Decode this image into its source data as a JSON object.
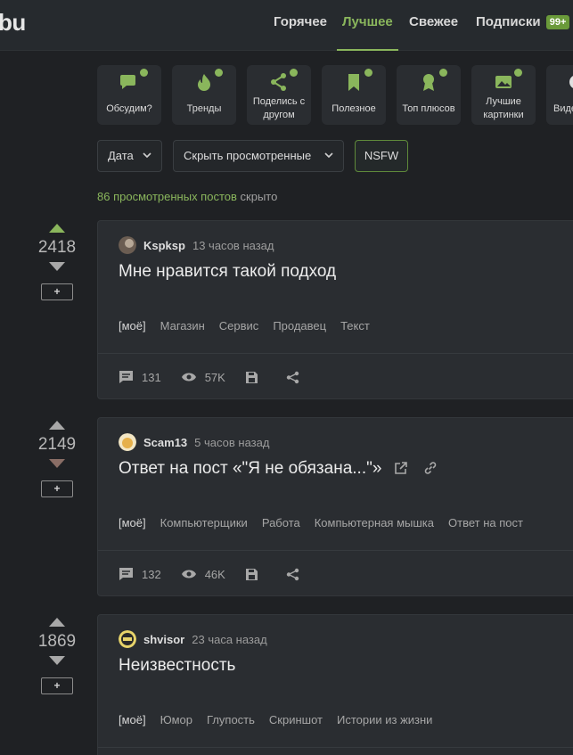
{
  "header": {
    "logo": "bu",
    "nav": [
      {
        "label": "Горячее",
        "active": false
      },
      {
        "label": "Лучшее",
        "active": true
      },
      {
        "label": "Свежее",
        "active": false
      },
      {
        "label": "Подписки",
        "active": false
      }
    ],
    "subscriptions_badge": "99+"
  },
  "categories": [
    {
      "line1": "Обсудим?",
      "line2": "",
      "icon": "chat-icon"
    },
    {
      "line1": "Тренды",
      "line2": "",
      "icon": "flame-icon"
    },
    {
      "line1": "Поделись с",
      "line2": "другом",
      "icon": "share-icon"
    },
    {
      "line1": "Полезное",
      "line2": "",
      "icon": "bookmark-icon"
    },
    {
      "line1": "Топ плюсов",
      "line2": "",
      "icon": "award-icon"
    },
    {
      "line1": "Лучшие",
      "line2": "картинки",
      "icon": "image-icon"
    },
    {
      "line1": "Виде",
      "line2": "",
      "icon": "video-icon"
    }
  ],
  "filters": {
    "date": "Дата",
    "hide_viewed": "Скрыть просмотренные",
    "nsfw": "NSFW"
  },
  "hidden_note": {
    "link": "86 просмотренных постов",
    "suffix": "скрыто"
  },
  "accent_color": "#8ab65c",
  "posts": [
    {
      "rating": "2418",
      "vote_state": "up",
      "plus_label": "+",
      "author": "Kspksp",
      "time": "13 часов назад",
      "title": "Мне нравится такой подход",
      "tags": [
        "[моё]",
        "Магазин",
        "Сервис",
        "Продавец",
        "Текст"
      ],
      "comments": "131",
      "views": "57K"
    },
    {
      "rating": "2149",
      "vote_state": "down",
      "plus_label": "+",
      "author": "Scam13",
      "time": "5 часов назад",
      "title": "Ответ на пост «\"Я не обязана...\"»",
      "tags": [
        "[моё]",
        "Компьютерщики",
        "Работа",
        "Компьютерная мышка",
        "Ответ на пост"
      ],
      "comments": "132",
      "views": "46K"
    },
    {
      "rating": "1869",
      "vote_state": "none",
      "plus_label": "+",
      "author": "shvisor",
      "time": "23 часа назад",
      "title": "Неизвестность",
      "tags": [
        "[моё]",
        "Юмор",
        "Глупость",
        "Скриншот",
        "Истории из жизни"
      ],
      "comments": "",
      "views": ""
    }
  ]
}
